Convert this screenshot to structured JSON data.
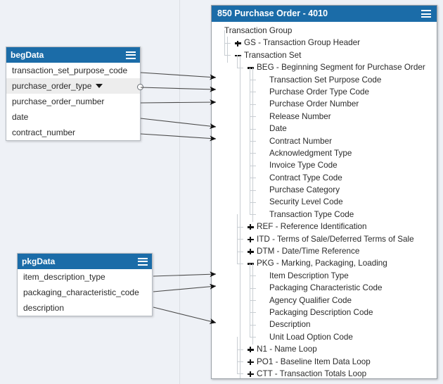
{
  "canvas": {
    "background": "#eef1f6",
    "gridline_color": "#dcdfe4",
    "accent": "#1b6ca8"
  },
  "nodes": [
    {
      "id": "begData",
      "title": "begData",
      "menu_icon": "hamburger-icon",
      "fields": [
        {
          "label": "transaction_set_purpose_code",
          "selected": false,
          "dropdown": false
        },
        {
          "label": "purchase_order_type",
          "selected": true,
          "dropdown": true
        },
        {
          "label": "purchase_order_number",
          "selected": false,
          "dropdown": false
        },
        {
          "label": "date",
          "selected": false,
          "dropdown": false
        },
        {
          "label": "contract_number",
          "selected": false,
          "dropdown": false
        }
      ]
    },
    {
      "id": "pkgData",
      "title": "pkgData",
      "menu_icon": "hamburger-icon",
      "fields": [
        {
          "label": "item_description_type",
          "selected": false,
          "dropdown": false
        },
        {
          "label": "packaging_characteristic_code",
          "selected": false,
          "dropdown": false
        },
        {
          "label": "description",
          "selected": false,
          "dropdown": false
        }
      ]
    }
  ],
  "tree_panel": {
    "title": "850 Purchase Order - 4010",
    "menu_icon": "hamburger-icon",
    "rows": [
      {
        "label": "Transaction Group",
        "depth": 0,
        "toggle": "none"
      },
      {
        "label": "GS - Transaction Group Header",
        "depth": 1,
        "toggle": "plus"
      },
      {
        "label": "Transaction Set",
        "depth": 1,
        "toggle": "minus"
      },
      {
        "label": "BEG - Beginning Segment for Purchase Order",
        "depth": 2,
        "toggle": "minus"
      },
      {
        "label": "Transaction Set Purpose Code",
        "depth": 3,
        "toggle": "none"
      },
      {
        "label": "Purchase Order Type Code",
        "depth": 3,
        "toggle": "none"
      },
      {
        "label": "Purchase Order Number",
        "depth": 3,
        "toggle": "none"
      },
      {
        "label": "Release Number",
        "depth": 3,
        "toggle": "none"
      },
      {
        "label": "Date",
        "depth": 3,
        "toggle": "none"
      },
      {
        "label": "Contract Number",
        "depth": 3,
        "toggle": "none"
      },
      {
        "label": "Acknowledgment Type",
        "depth": 3,
        "toggle": "none"
      },
      {
        "label": "Invoice Type Code",
        "depth": 3,
        "toggle": "none"
      },
      {
        "label": "Contract Type Code",
        "depth": 3,
        "toggle": "none"
      },
      {
        "label": "Purchase Category",
        "depth": 3,
        "toggle": "none"
      },
      {
        "label": "Security Level Code",
        "depth": 3,
        "toggle": "none"
      },
      {
        "label": "Transaction Type Code",
        "depth": 3,
        "toggle": "none"
      },
      {
        "label": "REF - Reference Identification",
        "depth": 2,
        "toggle": "plus"
      },
      {
        "label": "ITD - Terms of Sale/Deferred Terms of Sale",
        "depth": 2,
        "toggle": "plus"
      },
      {
        "label": "DTM - Date/Time Reference",
        "depth": 2,
        "toggle": "plus"
      },
      {
        "label": "PKG - Marking, Packaging, Loading",
        "depth": 2,
        "toggle": "minus"
      },
      {
        "label": "Item Description Type",
        "depth": 3,
        "toggle": "none"
      },
      {
        "label": "Packaging Characteristic Code",
        "depth": 3,
        "toggle": "none"
      },
      {
        "label": "Agency Qualifier Code",
        "depth": 3,
        "toggle": "none"
      },
      {
        "label": "Packaging Description Code",
        "depth": 3,
        "toggle": "none"
      },
      {
        "label": "Description",
        "depth": 3,
        "toggle": "none"
      },
      {
        "label": "Unit Load Option Code",
        "depth": 3,
        "toggle": "none"
      },
      {
        "label": "N1 - Name Loop",
        "depth": 2,
        "toggle": "plus"
      },
      {
        "label": "PO1 - Baseline Item Data Loop",
        "depth": 2,
        "toggle": "plus"
      },
      {
        "label": "CTT - Transaction Totals Loop",
        "depth": 2,
        "toggle": "plus"
      }
    ]
  },
  "connections": [
    {
      "from": "begData.transaction_set_purpose_code",
      "to": "Transaction Set Purpose Code"
    },
    {
      "from": "begData.purchase_order_type",
      "to": "Purchase Order Type Code"
    },
    {
      "from": "begData.purchase_order_number",
      "to": "Purchase Order Number"
    },
    {
      "from": "begData.date",
      "to": "Date"
    },
    {
      "from": "begData.contract_number",
      "to": "Contract Number"
    },
    {
      "from": "pkgData.item_description_type",
      "to": "Item Description Type"
    },
    {
      "from": "pkgData.packaging_characteristic_code",
      "to": "Packaging Characteristic Code"
    },
    {
      "from": "pkgData.description",
      "to": "Description"
    }
  ]
}
